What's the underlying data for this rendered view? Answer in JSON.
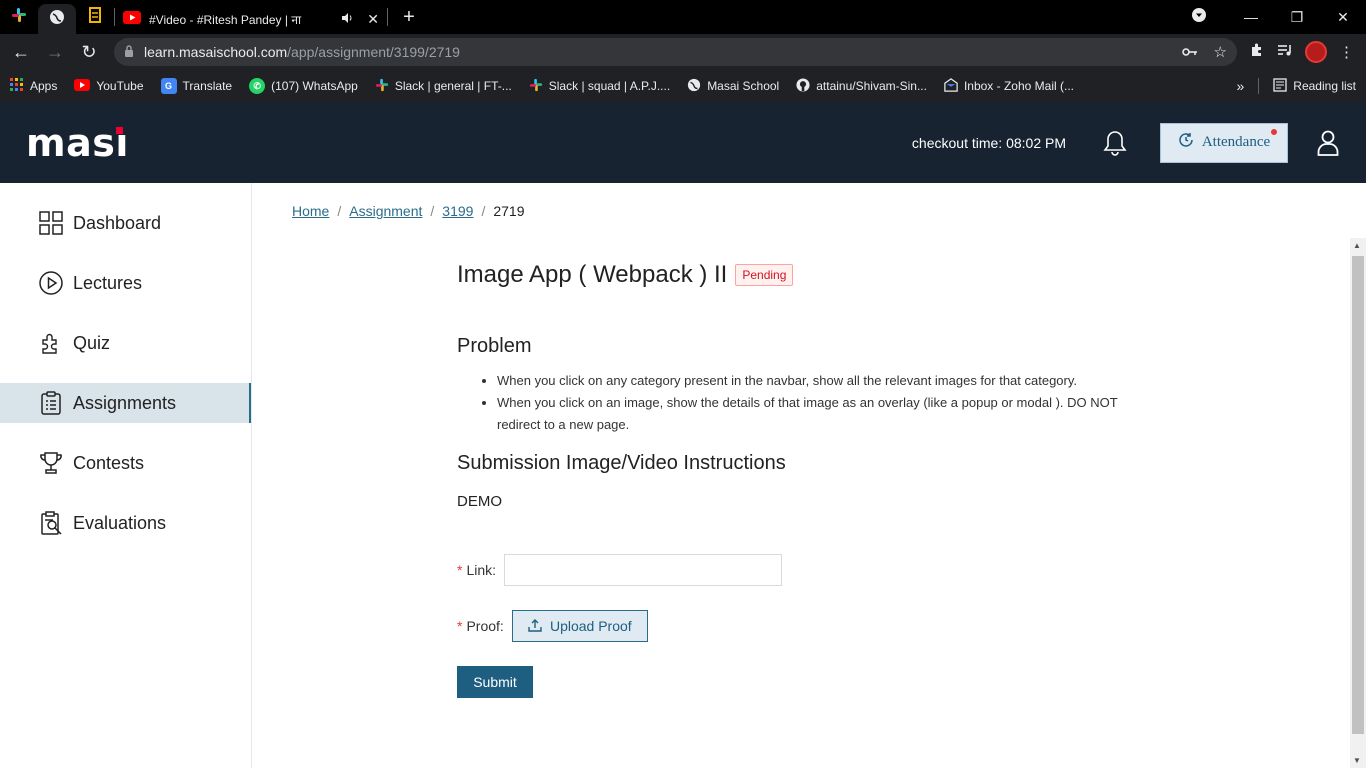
{
  "browser": {
    "tabs": [
      {
        "title": "",
        "icon": "slack-icon"
      },
      {
        "title": "",
        "icon": "globe-icon"
      },
      {
        "title": "",
        "icon": "bookmark-icon"
      },
      {
        "title": "#Video - #Ritesh Pandey | ना",
        "icon": "youtube-icon",
        "playing": true
      }
    ],
    "url_host": "learn.masaischool.com",
    "url_path": "/app/assignment/3199/2719",
    "bookmarks": [
      {
        "label": "Apps",
        "icon": "apps-grid-icon"
      },
      {
        "label": "YouTube",
        "icon": "youtube-icon"
      },
      {
        "label": "Translate",
        "icon": "translate-icon"
      },
      {
        "label": "(107) WhatsApp",
        "icon": "whatsapp-icon"
      },
      {
        "label": "Slack | general | FT-...",
        "icon": "slack-icon"
      },
      {
        "label": "Slack | squad | A.P.J....",
        "icon": "slack-icon"
      },
      {
        "label": "Masai School",
        "icon": "globe-icon"
      },
      {
        "label": "attainu/Shivam-Sin...",
        "icon": "github-icon"
      },
      {
        "label": "Inbox - Zoho Mail (...",
        "icon": "zoho-icon"
      }
    ],
    "more_bookmarks": "»",
    "reading_list": "Reading list"
  },
  "header": {
    "logo": "masai",
    "checkout_time": "checkout time: 08:02 PM",
    "attendance_label": "Attendance"
  },
  "sidebar": {
    "items": [
      {
        "label": "Dashboard",
        "icon": "dashboard-grid-icon",
        "active": false
      },
      {
        "label": "Lectures",
        "icon": "play-circle-icon",
        "active": false
      },
      {
        "label": "Quiz",
        "icon": "puzzle-icon",
        "active": false
      },
      {
        "label": "Assignments",
        "icon": "clipboard-icon",
        "active": true
      },
      {
        "label": "Contests",
        "icon": "trophy-icon",
        "active": false
      },
      {
        "label": "Evaluations",
        "icon": "evaluation-icon",
        "active": false
      }
    ]
  },
  "breadcrumb": {
    "items": [
      "Home",
      "Assignment",
      "3199"
    ],
    "current": "2719",
    "separator": "/"
  },
  "assignment": {
    "title": "Image App ( Webpack ) II",
    "status": "Pending",
    "problem_heading": "Problem",
    "problem_points": [
      "When you click on any category present in the navbar, show all the relevant images for that category.",
      "When you click on an image, show the details of that image as an overlay (like a popup or modal ). DO NOT redirect to a new page."
    ],
    "submission_heading": "Submission Image/Video Instructions",
    "demo_label": "DEMO"
  },
  "form": {
    "link_label": "Link:",
    "link_value": "",
    "proof_label": "Proof:",
    "upload_label": "Upload Proof",
    "submit_label": "Submit",
    "required_mark": "*"
  },
  "colors": {
    "header_bg": "#172330",
    "accent": "#1e5e80",
    "active_sidebar": "#d8e3ea",
    "badge_red": "#cf1322",
    "logo_red": "#ed0331"
  }
}
